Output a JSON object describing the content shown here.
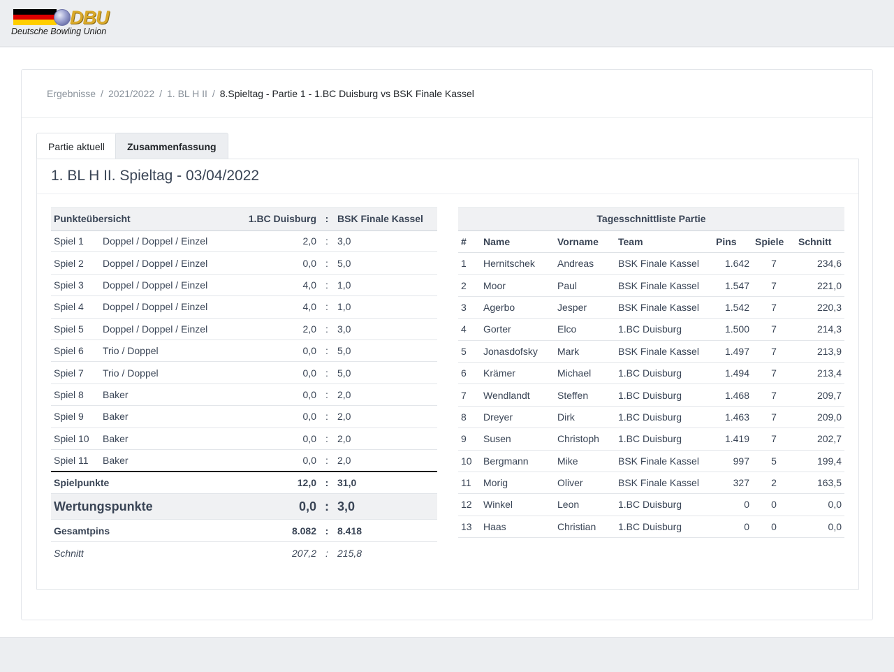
{
  "logo": {
    "mark": "DBU",
    "text": "Deutsche Bowling Union",
    "flag_colors": [
      "#000000",
      "#dd0000",
      "#ffce00"
    ]
  },
  "breadcrumb": [
    "Ergebnisse",
    "2021/2022",
    "1. BL H II",
    "8.Spieltag - Partie 1 - 1.BC Duisburg vs BSK Finale Kassel"
  ],
  "tabs": [
    "Partie aktuell",
    "Zusammenfassung"
  ],
  "active_tab": "Zusammenfassung",
  "section_title": "1. BL H II. Spieltag - 03/04/2022",
  "points": {
    "header": {
      "label": "Punkteübersicht",
      "home": "1.BC Duisburg",
      "sep": ":",
      "away": "BSK Finale Kassel"
    },
    "rows": [
      {
        "spiel": "Spiel 1",
        "disc": "Doppel / Doppel / Einzel",
        "home": "2,0",
        "away": "3,0"
      },
      {
        "spiel": "Spiel 2",
        "disc": "Doppel / Doppel / Einzel",
        "home": "0,0",
        "away": "5,0"
      },
      {
        "spiel": "Spiel 3",
        "disc": "Doppel / Doppel / Einzel",
        "home": "4,0",
        "away": "1,0"
      },
      {
        "spiel": "Spiel 4",
        "disc": "Doppel / Doppel / Einzel",
        "home": "4,0",
        "away": "1,0"
      },
      {
        "spiel": "Spiel 5",
        "disc": "Doppel / Doppel / Einzel",
        "home": "2,0",
        "away": "3,0"
      },
      {
        "spiel": "Spiel 6",
        "disc": "Trio / Doppel",
        "home": "0,0",
        "away": "5,0"
      },
      {
        "spiel": "Spiel 7",
        "disc": "Trio / Doppel",
        "home": "0,0",
        "away": "5,0"
      },
      {
        "spiel": "Spiel 8",
        "disc": "Baker",
        "home": "0,0",
        "away": "2,0"
      },
      {
        "spiel": "Spiel 9",
        "disc": "Baker",
        "home": "0,0",
        "away": "2,0"
      },
      {
        "spiel": "Spiel 10",
        "disc": "Baker",
        "home": "0,0",
        "away": "2,0"
      },
      {
        "spiel": "Spiel 11",
        "disc": "Baker",
        "home": "0,0",
        "away": "2,0"
      }
    ],
    "spielpunkte": {
      "label": "Spielpunkte",
      "home": "12,0",
      "away": "31,0"
    },
    "wertungspunkte": {
      "label": "Wertungspunkte",
      "home": "0,0",
      "away": "3,0"
    },
    "gesamtpins": {
      "label": "Gesamtpins",
      "home": "8.082",
      "away": "8.418"
    },
    "schnitt": {
      "label": "Schnitt",
      "home": "207,2",
      "away": "215,8"
    }
  },
  "ranking": {
    "caption": "Tagesschnittliste Partie",
    "columns": [
      "#",
      "Name",
      "Vorname",
      "Team",
      "Pins",
      "Spiele",
      "Schnitt"
    ],
    "rows": [
      {
        "rank": "1",
        "name": "Hernitschek",
        "vorname": "Andreas",
        "team": "BSK Finale Kassel",
        "pins": "1.642",
        "spiele": "7",
        "schnitt": "234,6"
      },
      {
        "rank": "2",
        "name": "Moor",
        "vorname": "Paul",
        "team": "BSK Finale Kassel",
        "pins": "1.547",
        "spiele": "7",
        "schnitt": "221,0"
      },
      {
        "rank": "3",
        "name": "Agerbo",
        "vorname": "Jesper",
        "team": "BSK Finale Kassel",
        "pins": "1.542",
        "spiele": "7",
        "schnitt": "220,3"
      },
      {
        "rank": "4",
        "name": "Gorter",
        "vorname": "Elco",
        "team": "1.BC Duisburg",
        "pins": "1.500",
        "spiele": "7",
        "schnitt": "214,3"
      },
      {
        "rank": "5",
        "name": "Jonasdofsky",
        "vorname": "Mark",
        "team": "BSK Finale Kassel",
        "pins": "1.497",
        "spiele": "7",
        "schnitt": "213,9"
      },
      {
        "rank": "6",
        "name": "Krämer",
        "vorname": "Michael",
        "team": "1.BC Duisburg",
        "pins": "1.494",
        "spiele": "7",
        "schnitt": "213,4"
      },
      {
        "rank": "7",
        "name": "Wendlandt",
        "vorname": "Steffen",
        "team": "1.BC Duisburg",
        "pins": "1.468",
        "spiele": "7",
        "schnitt": "209,7"
      },
      {
        "rank": "8",
        "name": "Dreyer",
        "vorname": "Dirk",
        "team": "1.BC Duisburg",
        "pins": "1.463",
        "spiele": "7",
        "schnitt": "209,0"
      },
      {
        "rank": "9",
        "name": "Susen",
        "vorname": "Christoph",
        "team": "1.BC Duisburg",
        "pins": "1.419",
        "spiele": "7",
        "schnitt": "202,7"
      },
      {
        "rank": "10",
        "name": "Bergmann",
        "vorname": "Mike",
        "team": "BSK Finale Kassel",
        "pins": "997",
        "spiele": "5",
        "schnitt": "199,4"
      },
      {
        "rank": "11",
        "name": "Morig",
        "vorname": "Oliver",
        "team": "BSK Finale Kassel",
        "pins": "327",
        "spiele": "2",
        "schnitt": "163,5"
      },
      {
        "rank": "12",
        "name": "Winkel",
        "vorname": "Leon",
        "team": "1.BC Duisburg",
        "pins": "0",
        "spiele": "0",
        "schnitt": "0,0"
      },
      {
        "rank": "13",
        "name": "Haas",
        "vorname": "Christian",
        "team": "1.BC Duisburg",
        "pins": "0",
        "spiele": "0",
        "schnitt": "0,0"
      }
    ]
  }
}
